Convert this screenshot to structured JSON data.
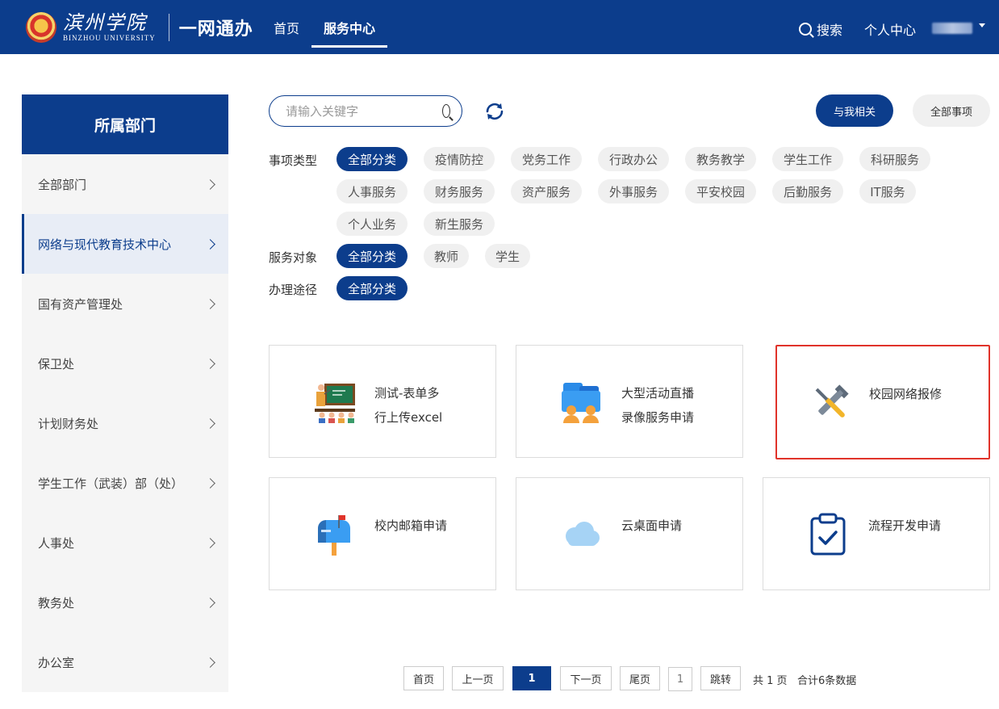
{
  "header": {
    "university_cn": "滨州学院",
    "university_en": "BINZHOU UNIVERSITY",
    "brand": "一网通办",
    "nav": {
      "home": "首页",
      "service": "服务中心"
    },
    "search": "搜索",
    "personal": "个人中心",
    "colors": {
      "primary": "#0c3d8c"
    }
  },
  "sidebar": {
    "title": "所属部门",
    "items": [
      {
        "label": "全部部门"
      },
      {
        "label": "网络与现代教育技术中心"
      },
      {
        "label": "国有资产管理处"
      },
      {
        "label": "保卫处"
      },
      {
        "label": "计划财务处"
      },
      {
        "label": "学生工作（武装）部（处）"
      },
      {
        "label": "人事处"
      },
      {
        "label": "教务处"
      },
      {
        "label": "办公室"
      }
    ]
  },
  "search": {
    "placeholder": "请输入关键字"
  },
  "buttons": {
    "mine": "与我相关",
    "all": "全部事项"
  },
  "filters": {
    "type_label": "事项类型",
    "types": [
      "全部分类",
      "疫情防控",
      "党务工作",
      "行政办公",
      "教务教学",
      "学生工作",
      "科研服务",
      "人事服务",
      "财务服务",
      "资产服务",
      "外事服务",
      "平安校园",
      "后勤服务",
      "IT服务",
      "个人业务",
      "新生服务"
    ],
    "target_label": "服务对象",
    "targets": [
      "全部分类",
      "教师",
      "学生"
    ],
    "channel_label": "办理途径",
    "channels": [
      "全部分类"
    ]
  },
  "cards": [
    {
      "line1": "测试-表单多",
      "line2": "行上传excel",
      "icon": "classroom-icon"
    },
    {
      "line1": "大型活动直播",
      "line2": "录像服务申请",
      "icon": "live-stream-icon"
    },
    {
      "line1": "校园网络报修",
      "line2": "",
      "icon": "repair-tools-icon"
    },
    {
      "line1": "校内邮箱申请",
      "line2": "",
      "icon": "mailbox-icon"
    },
    {
      "line1": "云桌面申请",
      "line2": "",
      "icon": "cloud-icon"
    },
    {
      "line1": "流程开发申请",
      "line2": "",
      "icon": "clipboard-check-icon"
    }
  ],
  "pagination": {
    "first": "首页",
    "prev": "上一页",
    "current": "1",
    "next": "下一页",
    "last": "尾页",
    "jump_value": "1",
    "jump": "跳转",
    "total_pages": "共 1 页",
    "total_items": "合计6条数据"
  }
}
